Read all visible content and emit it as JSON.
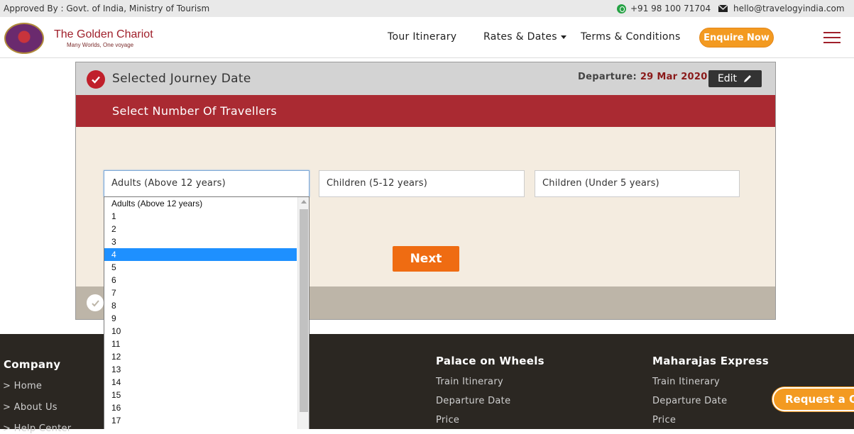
{
  "topbar": {
    "approved": "Approved By : Govt. of India, Ministry of Tourism",
    "phone": "+91 98 100 71704",
    "email": "hello@travelogyindia.com"
  },
  "header": {
    "brand": "The Golden Chariot",
    "tagline": "Many Worlds, One voyage",
    "nav": {
      "tour_itinerary": "Tour Itinerary",
      "rates_dates": "Rates & Dates",
      "terms": "Terms & Conditions"
    },
    "enquire": "Enquire Now"
  },
  "booking": {
    "step1_title": "Selected Journey Date",
    "departure_label": "Departure:",
    "departure_date": "29 Mar 2020",
    "edit_label": "Edit",
    "step2_title": "Select Number Of Travellers",
    "adults_value": "Adults (Above 12 years)",
    "children_5_12": "Children (5-12 years)",
    "children_under_5": "Children (Under 5 years)",
    "next_label": "Next"
  },
  "dropdown": {
    "options": [
      "Adults (Above 12 years)",
      "1",
      "2",
      "3",
      "4",
      "5",
      "6",
      "7",
      "8",
      "9",
      "10",
      "11",
      "12",
      "13",
      "14",
      "15",
      "16",
      "17"
    ],
    "highlighted": "4"
  },
  "footer": {
    "company": {
      "heading": "Company",
      "links": [
        "> Home",
        "> About Us",
        "> Help Center"
      ]
    },
    "palace": {
      "heading": "Palace on Wheels",
      "links": [
        "Train Itinerary",
        "Departure Date",
        "Price"
      ]
    },
    "maharajas": {
      "heading": "Maharajas Express",
      "links": [
        "Train Itinerary",
        "Departure Date",
        "Price"
      ]
    },
    "request_quote": "Request a Quote"
  },
  "colors": {
    "brand_red": "#aa2a32",
    "accent_orange": "#f39a21",
    "next_orange": "#ef6c12",
    "footer_bg": "#2b2722",
    "highlight_blue": "#1e90ff"
  }
}
